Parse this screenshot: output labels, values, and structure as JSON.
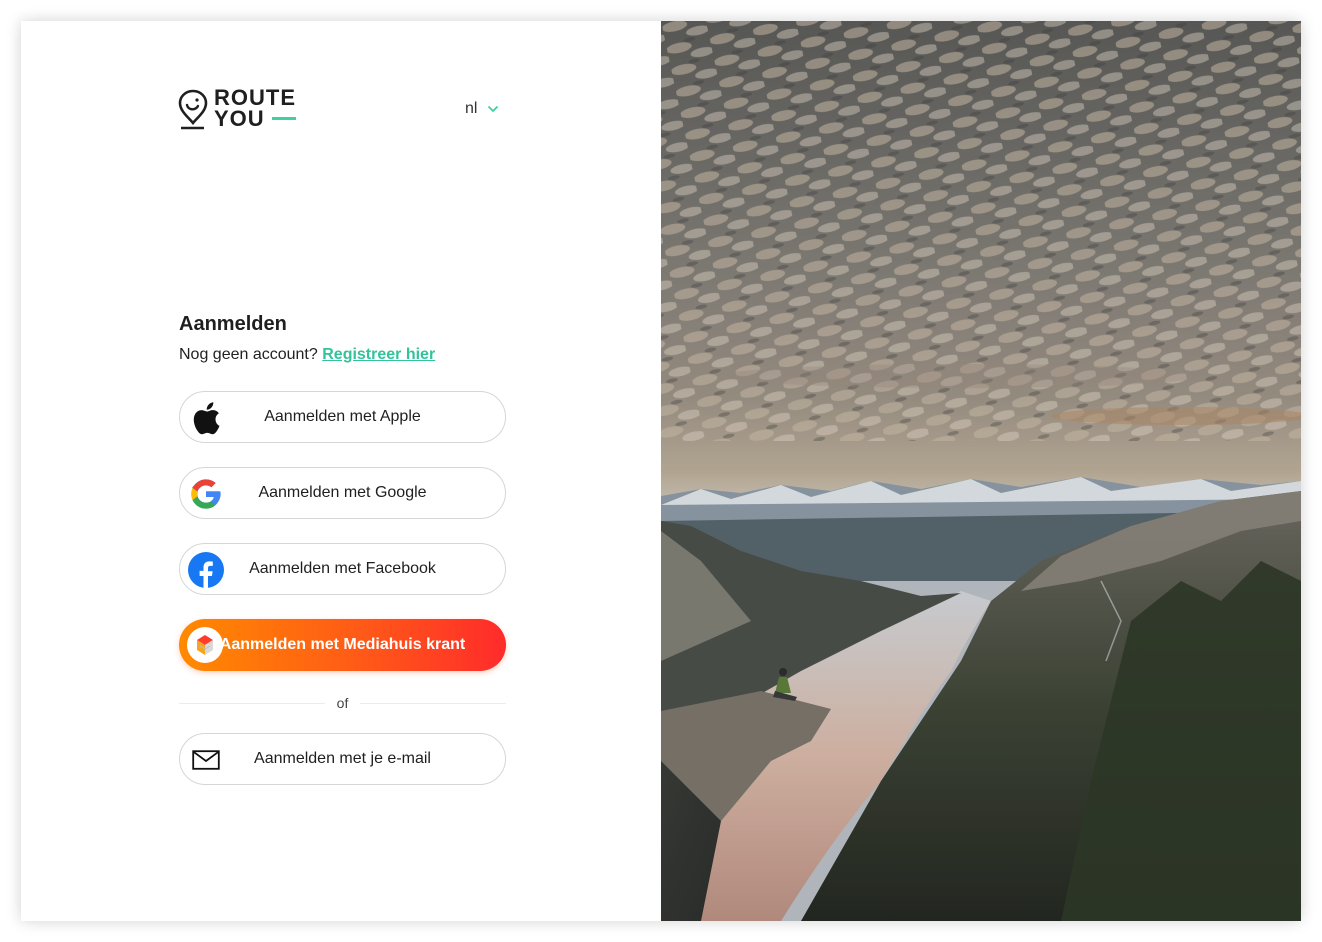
{
  "brand": {
    "line1": "ROUTE",
    "line2": "YOU",
    "accent": "#3dd0a0"
  },
  "language": {
    "selected": "nl"
  },
  "login": {
    "title": "Aanmelden",
    "no_account": "Nog geen account?",
    "register_link": "Registreer hier"
  },
  "buttons": {
    "apple": "Aanmelden met Apple",
    "google": "Aanmelden met Google",
    "facebook": "Aanmelden met Facebook",
    "mediahuis": "Aanmelden met Mediahuis krant",
    "email": "Aanmelden met je e-mail"
  },
  "divider": "of",
  "colors": {
    "link": "#33c39a",
    "mediahuis_start": "#ff8a00",
    "mediahuis_end": "#ff2b2b"
  }
}
